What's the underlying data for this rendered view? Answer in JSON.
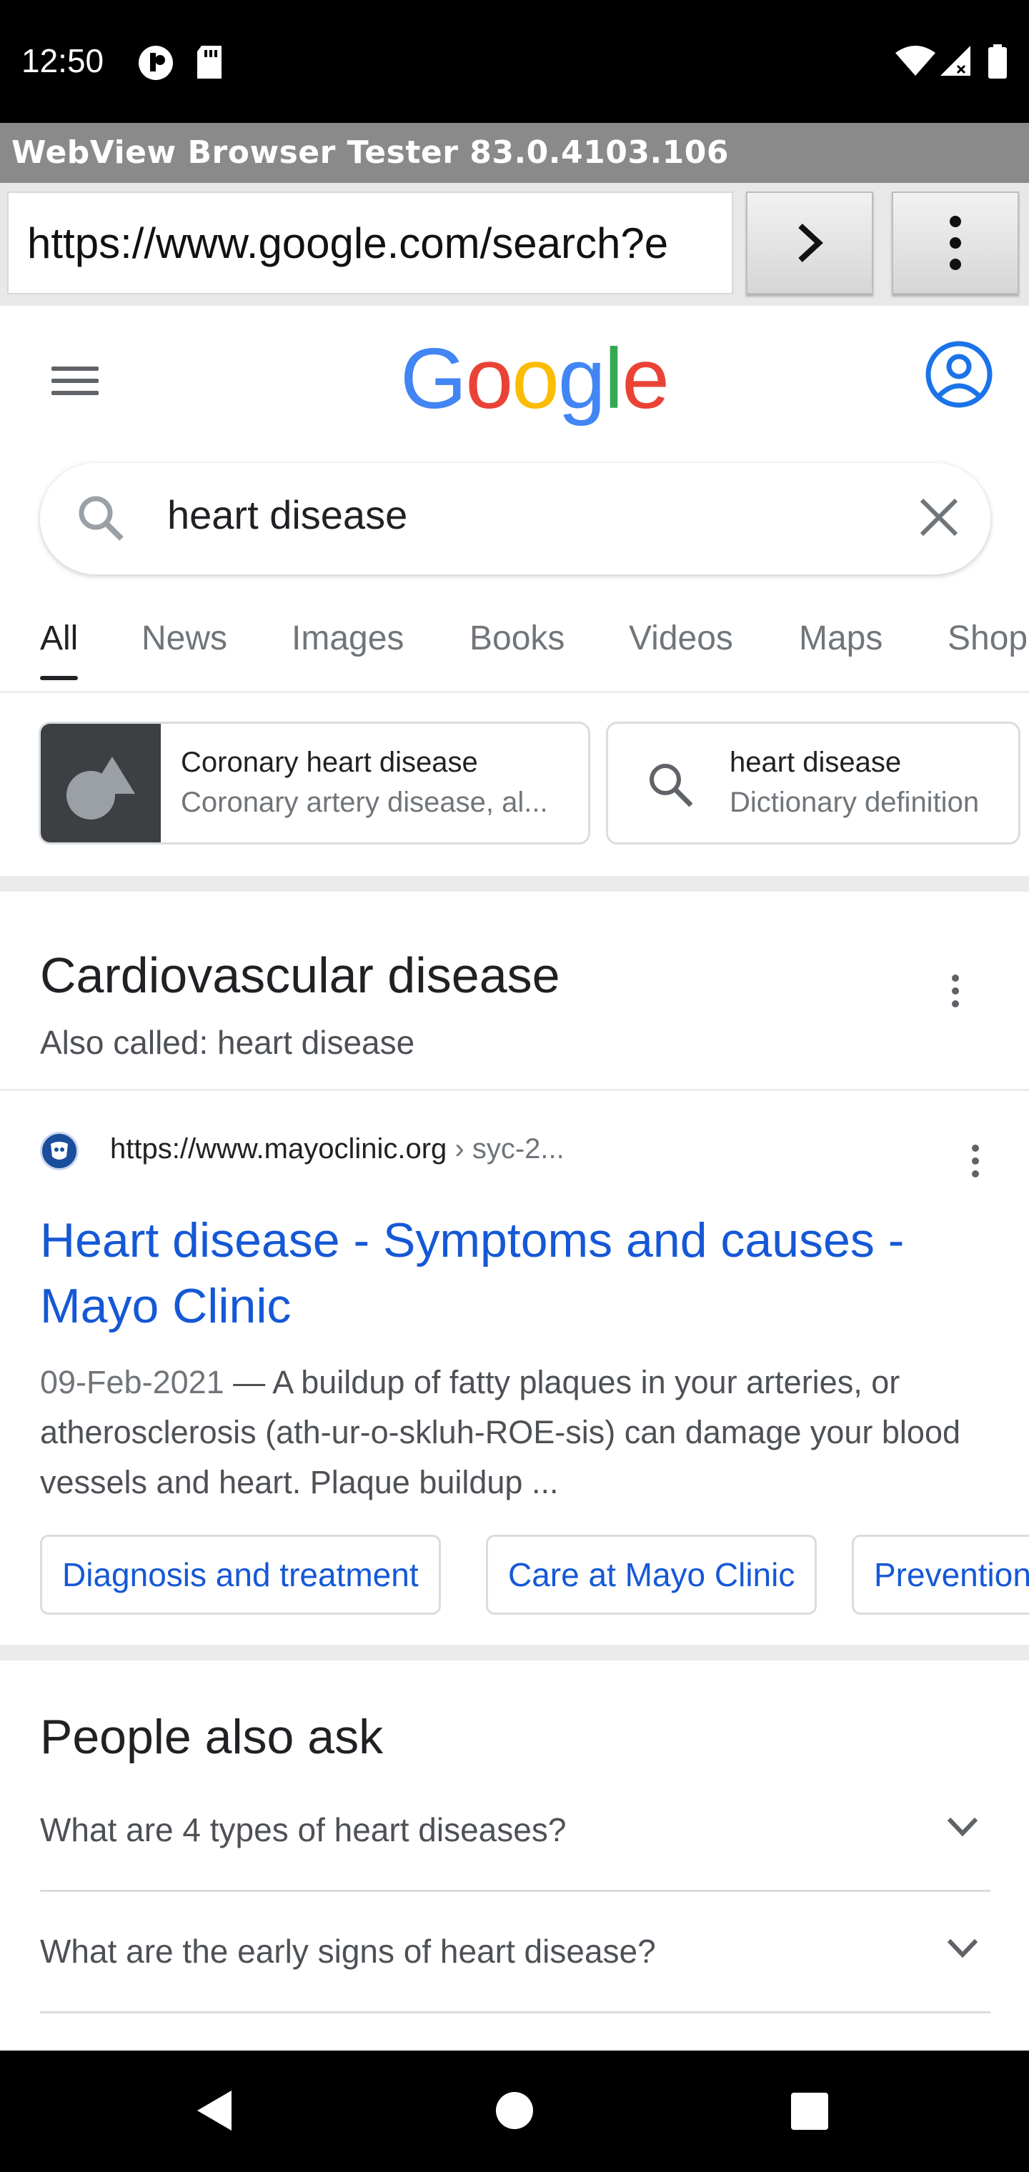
{
  "status_bar": {
    "time": "12:50"
  },
  "browser": {
    "title": "WebView Browser Tester 83.0.4103.106",
    "url": "https://www.google.com/search?e"
  },
  "google": {
    "logo_letters": [
      {
        "ch": "G",
        "color": "#4285F4"
      },
      {
        "ch": "o",
        "color": "#EA4335"
      },
      {
        "ch": "o",
        "color": "#FBBC05"
      },
      {
        "ch": "g",
        "color": "#4285F4"
      },
      {
        "ch": "l",
        "color": "#34A853"
      },
      {
        "ch": "e",
        "color": "#EA4335"
      }
    ],
    "query": "heart disease"
  },
  "tabs": [
    "All",
    "News",
    "Images",
    "Books",
    "Videos",
    "Maps",
    "Shop"
  ],
  "knowledge_chips": [
    {
      "title": "Coronary heart disease",
      "subtitle": "Coronary artery disease, al..."
    },
    {
      "title": "heart disease",
      "subtitle": "Dictionary definition"
    }
  ],
  "knowledge_panel": {
    "title": "Cardiovascular disease",
    "subtitle": "Also called: heart disease"
  },
  "result": {
    "url": "https://www.mayoclinic.org",
    "breadcrumb": " › syc-2...",
    "title": "Heart disease - Symptoms and causes - Mayo Clinic",
    "date": "09-Feb-2021",
    "snippet": " — A buildup of fatty plaques in your arteries, or atherosclerosis (ath-ur-o-skluh-ROE-sis) can damage your blood vessels and heart. Plaque buildup ...",
    "sitelinks": [
      "Diagnosis and treatment",
      "Care at Mayo Clinic",
      "Prevention"
    ]
  },
  "people_also_ask": {
    "title": "People also ask",
    "questions": [
      "What are 4 types of heart diseases?",
      "What are the early signs of heart disease?"
    ]
  },
  "colors": {
    "link_blue": "#1558d6",
    "account_blue": "#1a73e8"
  }
}
